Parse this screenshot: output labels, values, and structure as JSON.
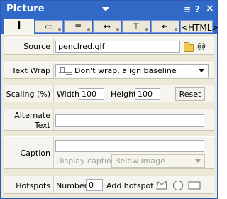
{
  "panel": {
    "title": "Picture",
    "help_icon": "?",
    "menu_icon": "≡",
    "close_icon": "×"
  },
  "tabs": [
    {
      "name": "info",
      "glyph": "i"
    },
    {
      "name": "border",
      "glyph": "▭"
    },
    {
      "name": "text-align",
      "glyph": "≡"
    },
    {
      "name": "spacing",
      "glyph": "↔"
    },
    {
      "name": "link",
      "glyph": "⊤"
    },
    {
      "name": "image-map",
      "glyph": "↵"
    },
    {
      "name": "html",
      "glyph": "<HTML>"
    }
  ],
  "source": {
    "label": "Source",
    "value": "pencIred.gif",
    "at_icon": "@"
  },
  "text_wrap": {
    "label": "Text Wrap",
    "value": "Don't wrap, align baseline"
  },
  "scaling": {
    "label": "Scaling (%)",
    "width_label": "Width",
    "width_value": "100",
    "height_label": "Height",
    "height_value": "100",
    "reset_label": "Reset"
  },
  "alternate_text": {
    "label_line1": "Alternate",
    "label_line2": "Text",
    "value": ""
  },
  "caption": {
    "label": "Caption",
    "value": "",
    "display_label": "Display caption",
    "display_value": "Below image"
  },
  "hotspots": {
    "label": "Hotspots",
    "number_label": "Number",
    "number_value": "0",
    "add_label": "Add hotspot"
  }
}
